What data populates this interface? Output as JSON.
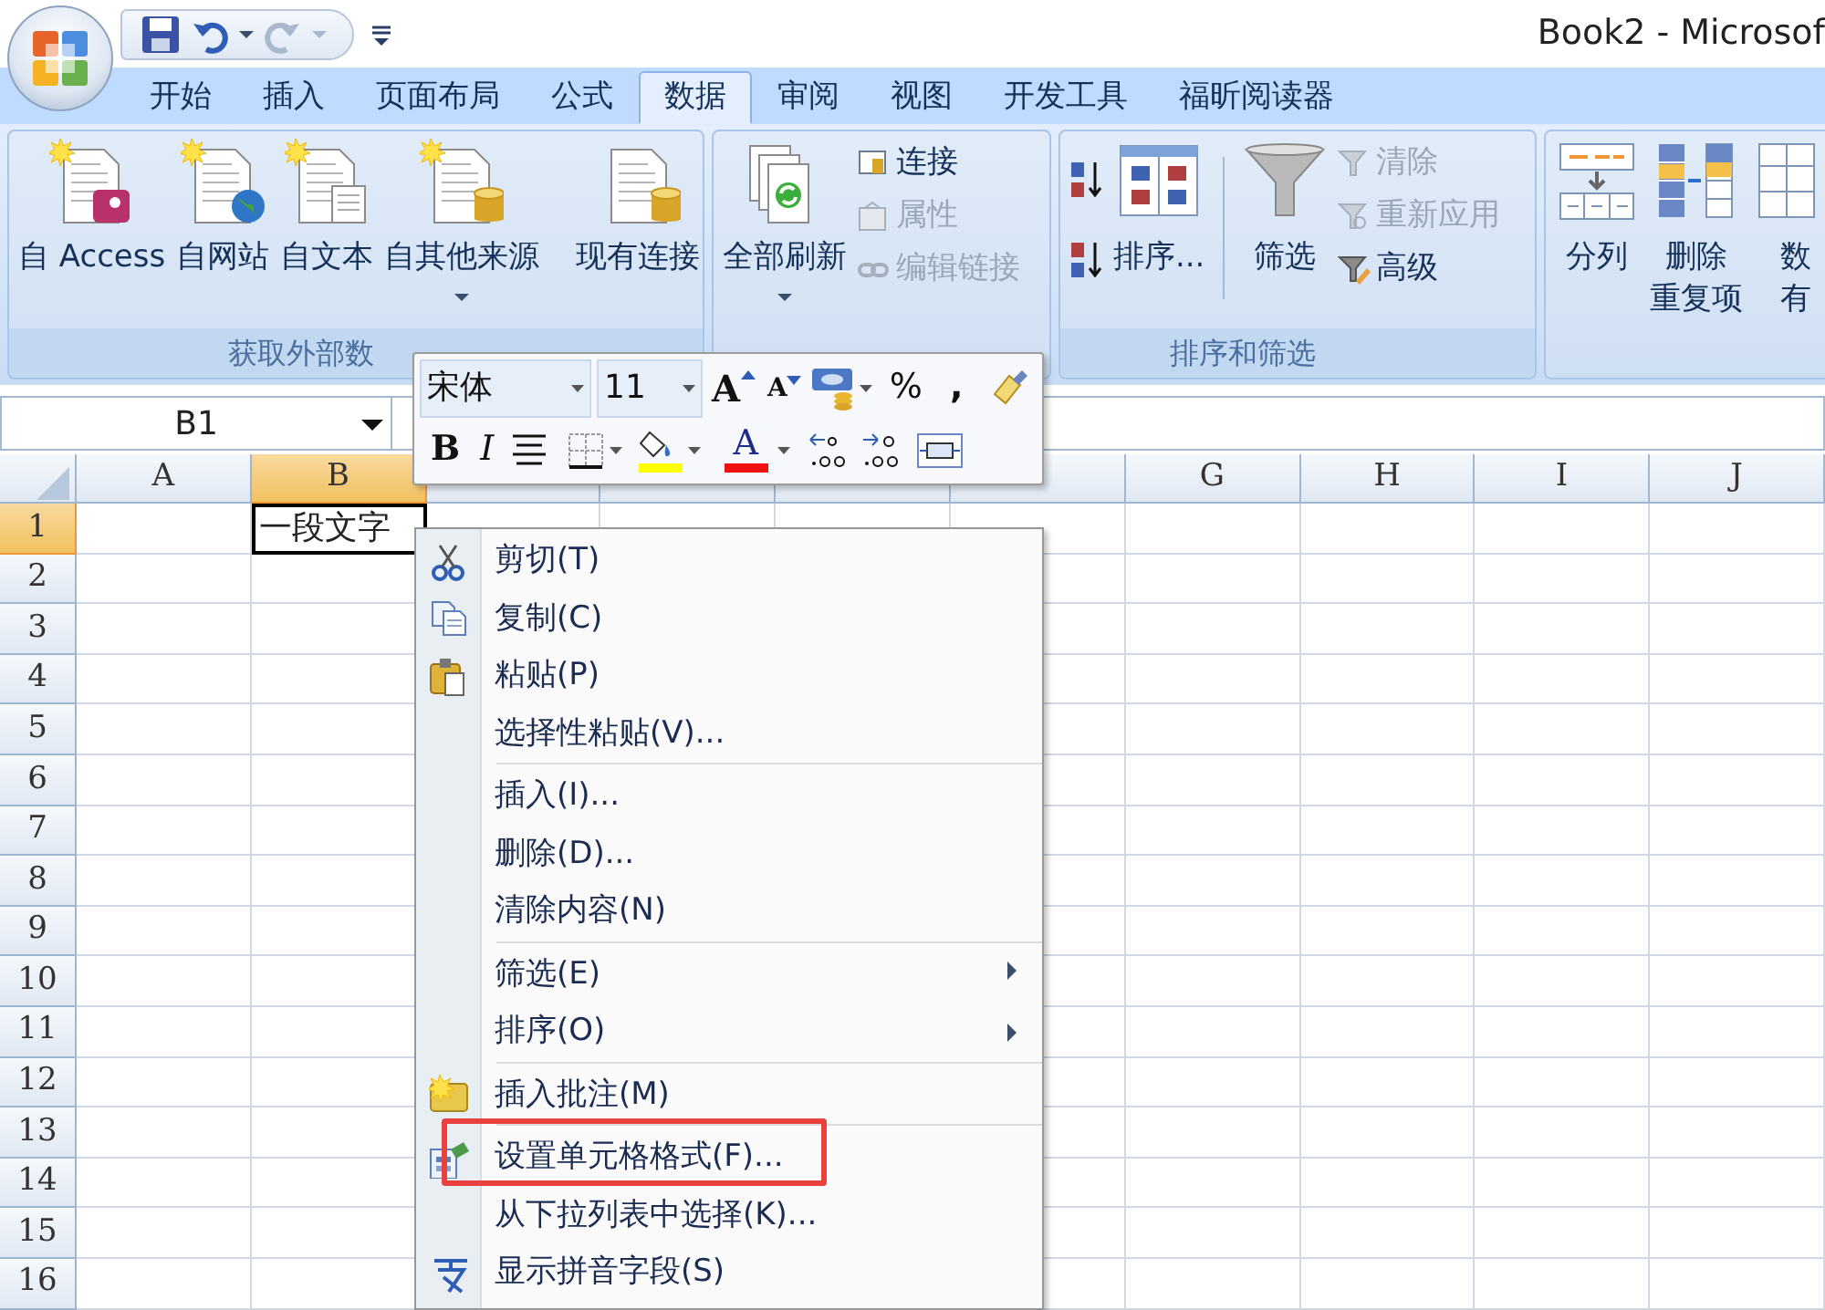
{
  "window": {
    "title": "Book2 - Microsof"
  },
  "tabs": [
    {
      "label": "开始",
      "selected": false
    },
    {
      "label": "插入",
      "selected": false
    },
    {
      "label": "页面布局",
      "selected": false
    },
    {
      "label": "公式",
      "selected": false
    },
    {
      "label": "数据",
      "selected": true
    },
    {
      "label": "审阅",
      "selected": false
    },
    {
      "label": "视图",
      "selected": false
    },
    {
      "label": "开发工具",
      "selected": false
    },
    {
      "label": "福昕阅读器",
      "selected": false
    }
  ],
  "ribbon": {
    "groups": [
      {
        "label": "获取外部数",
        "buttons": [
          {
            "kind": "large",
            "lines": [
              "自 Access"
            ],
            "dropdown": false
          },
          {
            "kind": "large",
            "lines": [
              "自网站"
            ],
            "dropdown": false
          },
          {
            "kind": "large",
            "lines": [
              "自文本"
            ],
            "dropdown": false
          },
          {
            "kind": "large",
            "lines": [
              "自其他来源"
            ],
            "dropdown": true
          },
          {
            "kind": "separator"
          },
          {
            "kind": "large",
            "lines": [
              "现有连接"
            ],
            "dropdown": false
          }
        ]
      },
      {
        "buttons": [
          {
            "kind": "large",
            "lines": [
              "全部刷新"
            ],
            "dropdown": true
          },
          {
            "kind": "stack",
            "items": [
              {
                "label": "连接",
                "disabled": false
              },
              {
                "label": "属性",
                "disabled": true
              },
              {
                "label": "编辑链接",
                "disabled": true
              }
            ]
          }
        ]
      },
      {
        "label": "排序和筛选",
        "buttons": [
          {
            "kind": "sort_pair"
          },
          {
            "kind": "large",
            "lines": [
              "排序..."
            ],
            "dropdown": false
          },
          {
            "kind": "separator"
          },
          {
            "kind": "large",
            "lines": [
              "筛选"
            ],
            "dropdown": false
          },
          {
            "kind": "stack",
            "items": [
              {
                "label": "清除",
                "disabled": true
              },
              {
                "label": "重新应用",
                "disabled": true
              },
              {
                "label": "高级",
                "disabled": false
              }
            ]
          }
        ]
      },
      {
        "buttons": [
          {
            "kind": "large",
            "lines": [
              "分列"
            ],
            "dropdown": false
          },
          {
            "kind": "large",
            "lines": [
              "删除",
              "重复项"
            ],
            "dropdown": false
          },
          {
            "kind": "large",
            "lines": [
              "数",
              "有"
            ],
            "dropdown": false
          }
        ]
      }
    ]
  },
  "formula_bar": {
    "name_box": "B1"
  },
  "mini_toolbar": {
    "font": "宋体",
    "size": "11",
    "grow_font": "A",
    "shrink_font": "A",
    "percent": "%",
    "comma": ",",
    "bold": "B",
    "italic": "I",
    "font_color": "A"
  },
  "sheet": {
    "columns": [
      {
        "label": "A",
        "selected": false
      },
      {
        "label": "B",
        "selected": true
      },
      {
        "selected": false
      },
      {
        "selected": false
      },
      {
        "selected": false
      },
      {
        "selected": false
      },
      {
        "label": "G",
        "selected": false
      },
      {
        "label": "H",
        "selected": false
      },
      {
        "label": "I",
        "selected": false
      },
      {
        "label": "J",
        "selected": false
      }
    ],
    "rows": [
      {
        "label": "1",
        "selected": true,
        "cells": [
          null,
          {
            "text": "一段文字",
            "active": true
          }
        ]
      },
      {
        "label": "2",
        "selected": false
      },
      {
        "label": "3",
        "selected": false
      },
      {
        "label": "4",
        "selected": false
      },
      {
        "label": "5",
        "selected": false
      },
      {
        "label": "6",
        "selected": false
      },
      {
        "label": "7",
        "selected": false
      },
      {
        "label": "8",
        "selected": false
      },
      {
        "label": "9",
        "selected": false
      },
      {
        "label": "10",
        "selected": false
      },
      {
        "label": "11",
        "selected": false
      },
      {
        "label": "12",
        "selected": false
      },
      {
        "label": "13",
        "selected": false
      },
      {
        "label": "14",
        "selected": false
      },
      {
        "label": "15",
        "selected": false
      },
      {
        "label": "16",
        "selected": false
      }
    ]
  },
  "context_menu": {
    "items": [
      {
        "label": "剪切(T)",
        "separator_above": false,
        "submenu": false,
        "highlighted": false
      },
      {
        "label": "复制(C)",
        "separator_above": false,
        "submenu": false,
        "highlighted": false
      },
      {
        "label": "粘贴(P)",
        "separator_above": false,
        "submenu": false,
        "highlighted": false
      },
      {
        "label": "选择性粘贴(V)...",
        "separator_above": false,
        "submenu": false,
        "highlighted": false
      },
      {
        "label": "插入(I)...",
        "separator_above": true,
        "submenu": false,
        "highlighted": false
      },
      {
        "label": "删除(D)...",
        "separator_above": false,
        "submenu": false,
        "highlighted": false
      },
      {
        "label": "清除内容(N)",
        "separator_above": false,
        "submenu": false,
        "highlighted": false
      },
      {
        "label": "筛选(E)",
        "separator_above": true,
        "submenu": true,
        "highlighted": false
      },
      {
        "label": "排序(O)",
        "separator_above": false,
        "submenu": true,
        "highlighted": false
      },
      {
        "label": "插入批注(M)",
        "separator_above": true,
        "submenu": false,
        "highlighted": false
      },
      {
        "label": "设置单元格格式(F)...",
        "separator_above": true,
        "submenu": false,
        "highlighted": true
      },
      {
        "label": "从下拉列表中选择(K)...",
        "separator_above": false,
        "submenu": false,
        "highlighted": false
      },
      {
        "label": "显示拼音字段(S)",
        "separator_above": false,
        "submenu": false,
        "highlighted": false
      }
    ]
  }
}
